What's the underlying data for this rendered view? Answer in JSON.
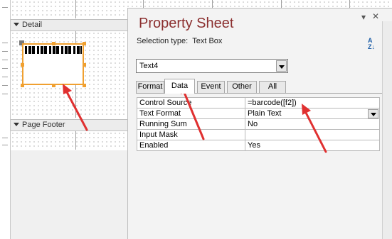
{
  "report": {
    "sections": {
      "detail_label": "Detail",
      "page_footer_label": "Page Footer"
    }
  },
  "property_sheet": {
    "title": "Property Sheet",
    "selection_type_label": "Selection type:",
    "selection_type_value": "Text Box",
    "selected_object": "Text4",
    "tabs": [
      "Format",
      "Data",
      "Event",
      "Other",
      "All"
    ],
    "active_tab": "Data",
    "properties": [
      {
        "name": "Control Source",
        "value": "=barcode([f2])"
      },
      {
        "name": "Text Format",
        "value": "Plain Text"
      },
      {
        "name": "Running Sum",
        "value": "No"
      },
      {
        "name": "Input Mask",
        "value": ""
      },
      {
        "name": "Enabled",
        "value": "Yes"
      }
    ],
    "icons": {
      "dropdown": "chevron-down-icon",
      "close": "close-icon",
      "sort": "sort-az-icon"
    }
  },
  "colors": {
    "title": "#8b2f2f",
    "selection_border": "#f0a030",
    "annotation_arrow": "#e03030"
  }
}
